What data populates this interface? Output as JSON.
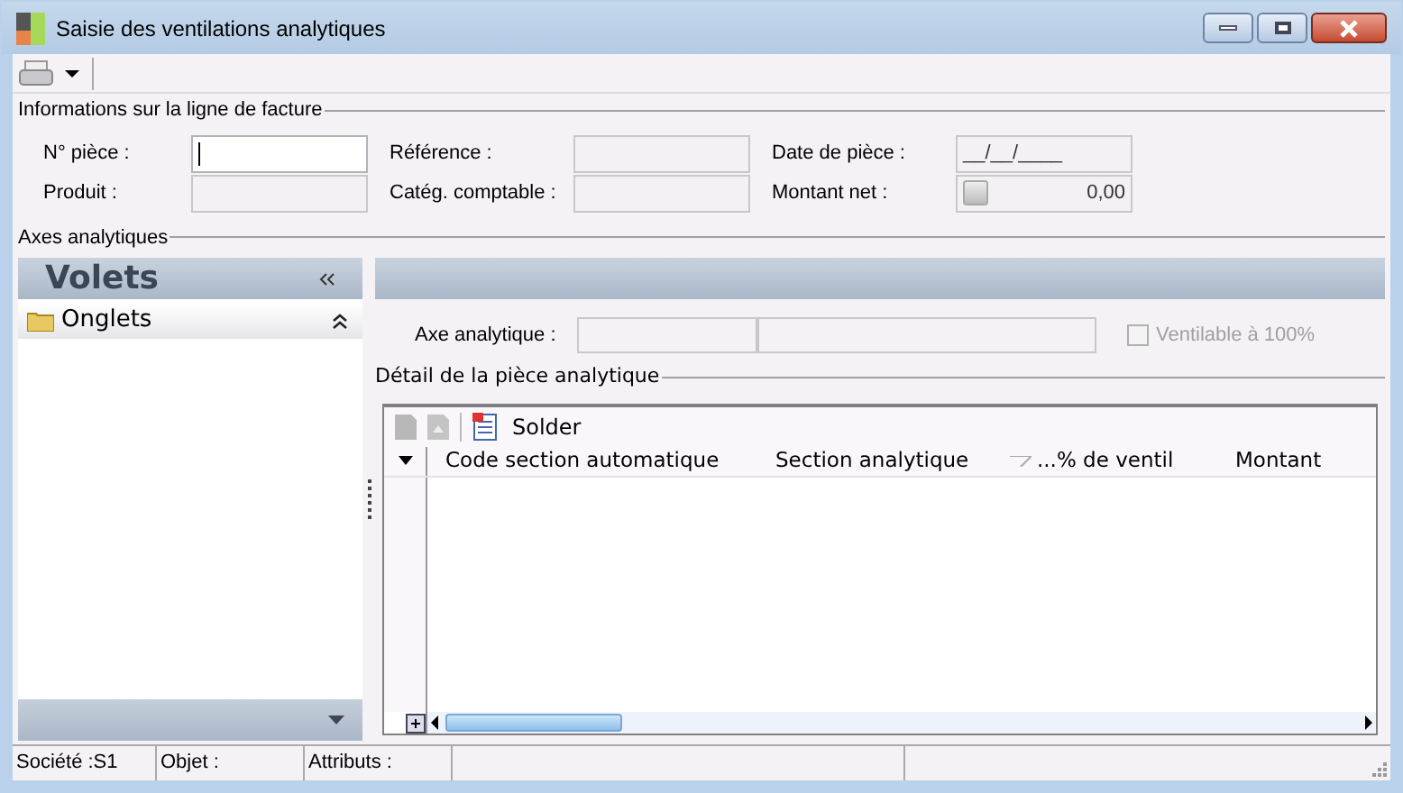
{
  "window": {
    "title": "Saisie des ventilations analytiques"
  },
  "invoice_info": {
    "title": "Informations sur la ligne de facture",
    "fields": [
      {
        "label": "N° pièce :",
        "focused": true
      },
      {
        "label": "Référence :",
        "focused": false
      },
      {
        "label": "Date de pièce :",
        "value": "__/__/____",
        "focused": false
      },
      {
        "label": "Produit :",
        "focused": false
      },
      {
        "label": "Catég. comptable :",
        "focused": false
      },
      {
        "label": "Montant net :",
        "value": "0,00",
        "kind": "amount",
        "focused": false
      }
    ]
  },
  "axes": {
    "title": "Axes analytiques"
  },
  "volets": {
    "title": "Volets",
    "items": [
      {
        "label": "Onglets",
        "expanded": true
      }
    ]
  },
  "axe_field": {
    "label": "Axe analytique :"
  },
  "ventilable": {
    "label": "Ventilable à 100%",
    "checked": false,
    "disabled": true
  },
  "detail": {
    "title": "Détail de la pièce analytique",
    "solder": "Solder",
    "columns": [
      {
        "label": "Code section automatique",
        "filter": false
      },
      {
        "label": "Section analytique",
        "filter": false
      },
      {
        "label": "...% de ventil",
        "filter": true
      },
      {
        "label": "Montant",
        "filter": false
      }
    ]
  },
  "status_bar": [
    "Société :S1",
    "Objet :",
    "Attributs :"
  ]
}
